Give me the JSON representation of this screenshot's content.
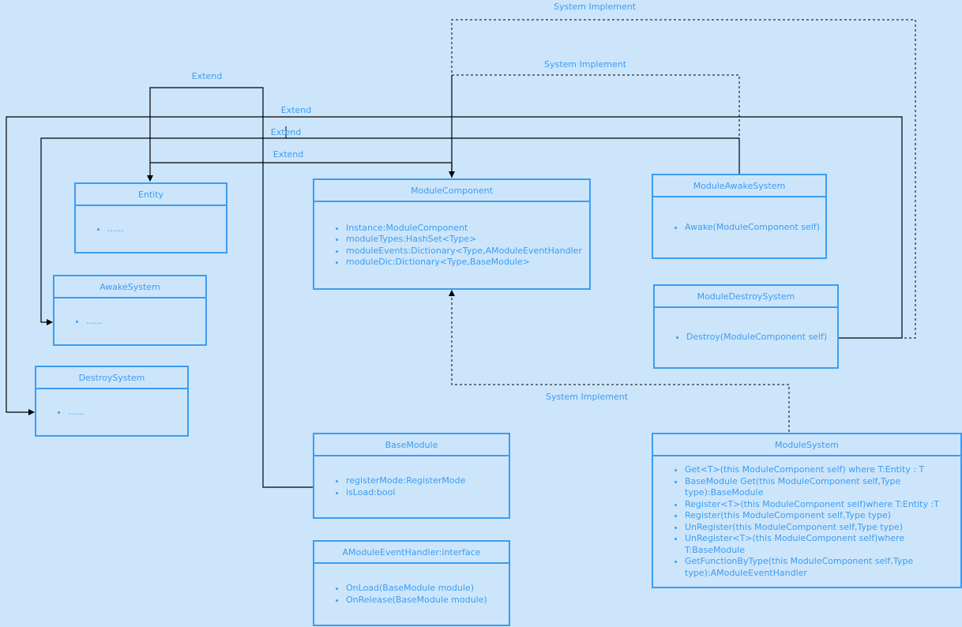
{
  "colors": {
    "background": "#cce5fb",
    "box_border": "#3d9cf0",
    "text": "#3d9cf0",
    "connector": "#000000"
  },
  "connectors": {
    "extend_label": "Extend",
    "implement_label": "System Implement"
  },
  "labels": [
    {
      "id": "extend-entity",
      "text": "Extend"
    },
    {
      "id": "extend-destroy",
      "text": "Extend"
    },
    {
      "id": "extend-awake",
      "text": "Extend"
    },
    {
      "id": "extend-component",
      "text": "Extend"
    },
    {
      "id": "implement-destroy",
      "text": "System Implement"
    },
    {
      "id": "implement-awake",
      "text": "System Implement"
    },
    {
      "id": "implement-modulesystem",
      "text": "System Implement"
    }
  ],
  "classes": {
    "entity": {
      "title": "Entity",
      "members": [
        "......"
      ]
    },
    "awake_system": {
      "title": "AwakeSystem",
      "members": [
        "......"
      ]
    },
    "destroy_system": {
      "title": "DestroySystem",
      "members": [
        "......"
      ]
    },
    "module_component": {
      "title": "ModuleComponent",
      "members": [
        "Instance:ModuleComponent",
        "moduleTypes:HashSet<Type>",
        "moduleEvents:Dictionary<Type,AModuleEventHandler",
        "moduleDic:Dictionary<Type,BaseModule>"
      ]
    },
    "module_awake_system": {
      "title": "ModuleAwakeSystem",
      "members": [
        "Awake(ModuleComponent self)"
      ]
    },
    "module_destroy_system": {
      "title": "ModuleDestroySystem",
      "members": [
        "Destroy(ModuleComponent self)"
      ]
    },
    "base_module": {
      "title": "BaseModule",
      "members": [
        "registerMode:RegisterMode",
        "isLoad:bool"
      ]
    },
    "amodule_event_handler": {
      "title": "AModuleEventHandler:interface",
      "members": [
        "OnLoad(BaseModule module)",
        "OnRelease(BaseModule module)"
      ]
    },
    "module_system": {
      "title": "ModuleSystem",
      "members": [
        "Get<T>(this ModuleComponent self) where T:Entity : T",
        "BaseModule Get(this ModuleComponent self,Type type):BaseModule",
        "Register<T>(this ModuleComponent self)where T:Entity :T",
        "Register(this ModuleComponent self,Type type)",
        "UnRegister(this ModuleComponent self,Type type)",
        "UnRegister<T>(this ModuleComponent self)where T:BaseModule",
        "GetFunctionByType(this ModuleComponent self,Type type):AModuleEventHandler"
      ]
    }
  }
}
